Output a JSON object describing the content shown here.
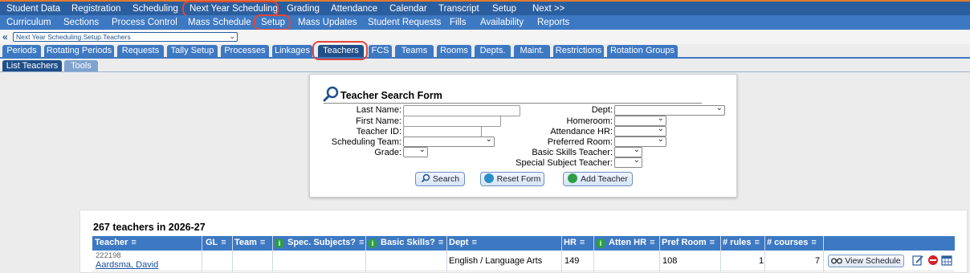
{
  "top_nav": [
    "Student Data",
    "Registration",
    "Scheduling",
    "Next Year Scheduling",
    "Grading",
    "Attendance",
    "Calendar",
    "Transcript",
    "Setup",
    "Next >>"
  ],
  "sub_nav": [
    "Curriculum",
    "Sections",
    "Process Control",
    "Mass Schedule",
    "Setup",
    "Mass Updates",
    "Student Requests",
    "Fills",
    "Availability",
    "Reports"
  ],
  "breadcrumb": {
    "value": "Next Year Scheduling.Setup.Teachers"
  },
  "tabs": [
    "Periods",
    "Rotating Periods",
    "Requests",
    "Tally Setup",
    "Processes",
    "Linkages",
    "Teachers",
    "FCS",
    "Teams",
    "Rooms",
    "Depts.",
    "Maint.",
    "Restrictions",
    "Rotation Groups"
  ],
  "subtabs": [
    "List Teachers",
    "Tools"
  ],
  "search_form": {
    "title": "Teacher Search Form",
    "labels": {
      "last_name": "Last Name:",
      "first_name": "First Name:",
      "teacher_id": "Teacher ID:",
      "scheduling_team": "Scheduling Team:",
      "grade": "Grade:",
      "dept": "Dept:",
      "homeroom": "Homeroom:",
      "attendance_hr": "Attendance HR:",
      "preferred_room": "Preferred Room:",
      "basic_skills": "Basic Skills Teacher:",
      "special_subject": "Special Subject Teacher:"
    },
    "buttons": {
      "search": "Search",
      "reset": "Reset Form",
      "add": "Add Teacher"
    }
  },
  "list": {
    "count_text": "267 teachers in 2026-27",
    "columns": [
      "Teacher",
      "GL",
      "Team",
      "Spec. Subjects?",
      "Basic Skills?",
      "Dept",
      "HR",
      "Atten HR",
      "Pref Room",
      "# rules",
      "# courses"
    ],
    "rows": [
      {
        "id": "222198",
        "name": "Aardsma, David",
        "dept": "English / Language Arts",
        "hr": "149",
        "pref_room": "108",
        "rules": "1",
        "courses": "7",
        "action": "View Schedule"
      }
    ]
  },
  "colors": {
    "nav_dark": "#2b5e9e",
    "nav_light": "#3d78c3",
    "highlight": "#e0473a",
    "info_green": "#2e9e47"
  }
}
